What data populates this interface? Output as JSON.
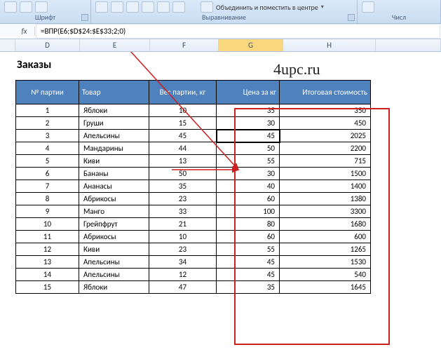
{
  "ribbon": {
    "font_group": "Шрифт",
    "align_group": "Выравнивание",
    "merge_label": "Объединить и поместить в центре",
    "number_group": "Числ"
  },
  "formula_bar": {
    "fx": "fx",
    "value": "=ВПР(E6;$D$24:$E$33;2;0)"
  },
  "columns": [
    "D",
    "E",
    "F",
    "G",
    "H"
  ],
  "active_column": "G",
  "title": "Заказы",
  "watermark": "4upc.ru",
  "headers": {
    "num": "№ партии",
    "product": "Товар",
    "weight": "Вес партии, кг",
    "price": "Цена за кг",
    "total": "Итоговая стоимость"
  },
  "rows": [
    {
      "num": 1,
      "product": "Яблоки",
      "weight": 10,
      "price": 35,
      "total": 350
    },
    {
      "num": 2,
      "product": "Груши",
      "weight": 15,
      "price": 30,
      "total": 450
    },
    {
      "num": 3,
      "product": "Апельсины",
      "weight": 45,
      "price": 45,
      "total": 2025
    },
    {
      "num": 4,
      "product": "Мандарины",
      "weight": 44,
      "price": 50,
      "total": 2200
    },
    {
      "num": 5,
      "product": "Киви",
      "weight": 13,
      "price": 55,
      "total": 715
    },
    {
      "num": 6,
      "product": "Бананы",
      "weight": 50,
      "price": 30,
      "total": 1500
    },
    {
      "num": 7,
      "product": "Ананасы",
      "weight": 35,
      "price": 40,
      "total": 1400
    },
    {
      "num": 8,
      "product": "Абрикосы",
      "weight": 23,
      "price": 60,
      "total": 1380
    },
    {
      "num": 9,
      "product": "Манго",
      "weight": 33,
      "price": 100,
      "total": 3300
    },
    {
      "num": 10,
      "product": "Грейпфрут",
      "weight": 21,
      "price": 80,
      "total": 1680
    },
    {
      "num": 11,
      "product": "Абрикосы",
      "weight": 10,
      "price": 60,
      "total": 600
    },
    {
      "num": 12,
      "product": "Киви",
      "weight": 23,
      "price": 55,
      "total": 1265
    },
    {
      "num": 13,
      "product": "Апельсины",
      "weight": 34,
      "price": 45,
      "total": 1530
    },
    {
      "num": 14,
      "product": "Апельсины",
      "weight": 12,
      "price": 45,
      "total": 540
    },
    {
      "num": 15,
      "product": "Яблоки",
      "weight": 47,
      "price": 35,
      "total": 1645
    }
  ],
  "chart_data": {
    "type": "table",
    "title": "Заказы",
    "columns": [
      "№ партии",
      "Товар",
      "Вес партии, кг",
      "Цена за кг",
      "Итоговая стоимость"
    ],
    "data": [
      [
        1,
        "Яблоки",
        10,
        35,
        350
      ],
      [
        2,
        "Груши",
        15,
        30,
        450
      ],
      [
        3,
        "Апельсины",
        45,
        45,
        2025
      ],
      [
        4,
        "Мандарины",
        44,
        50,
        2200
      ],
      [
        5,
        "Киви",
        13,
        55,
        715
      ],
      [
        6,
        "Бананы",
        50,
        30,
        1500
      ],
      [
        7,
        "Ананасы",
        35,
        40,
        1400
      ],
      [
        8,
        "Абрикосы",
        23,
        60,
        1380
      ],
      [
        9,
        "Манго",
        33,
        100,
        3300
      ],
      [
        10,
        "Грейпфрут",
        21,
        80,
        1680
      ],
      [
        11,
        "Абрикосы",
        10,
        60,
        600
      ],
      [
        12,
        "Киви",
        23,
        55,
        1265
      ],
      [
        13,
        "Апельсины",
        34,
        45,
        1530
      ],
      [
        14,
        "Апельсины",
        12,
        45,
        540
      ],
      [
        15,
        "Яблоки",
        47,
        35,
        1645
      ]
    ]
  }
}
